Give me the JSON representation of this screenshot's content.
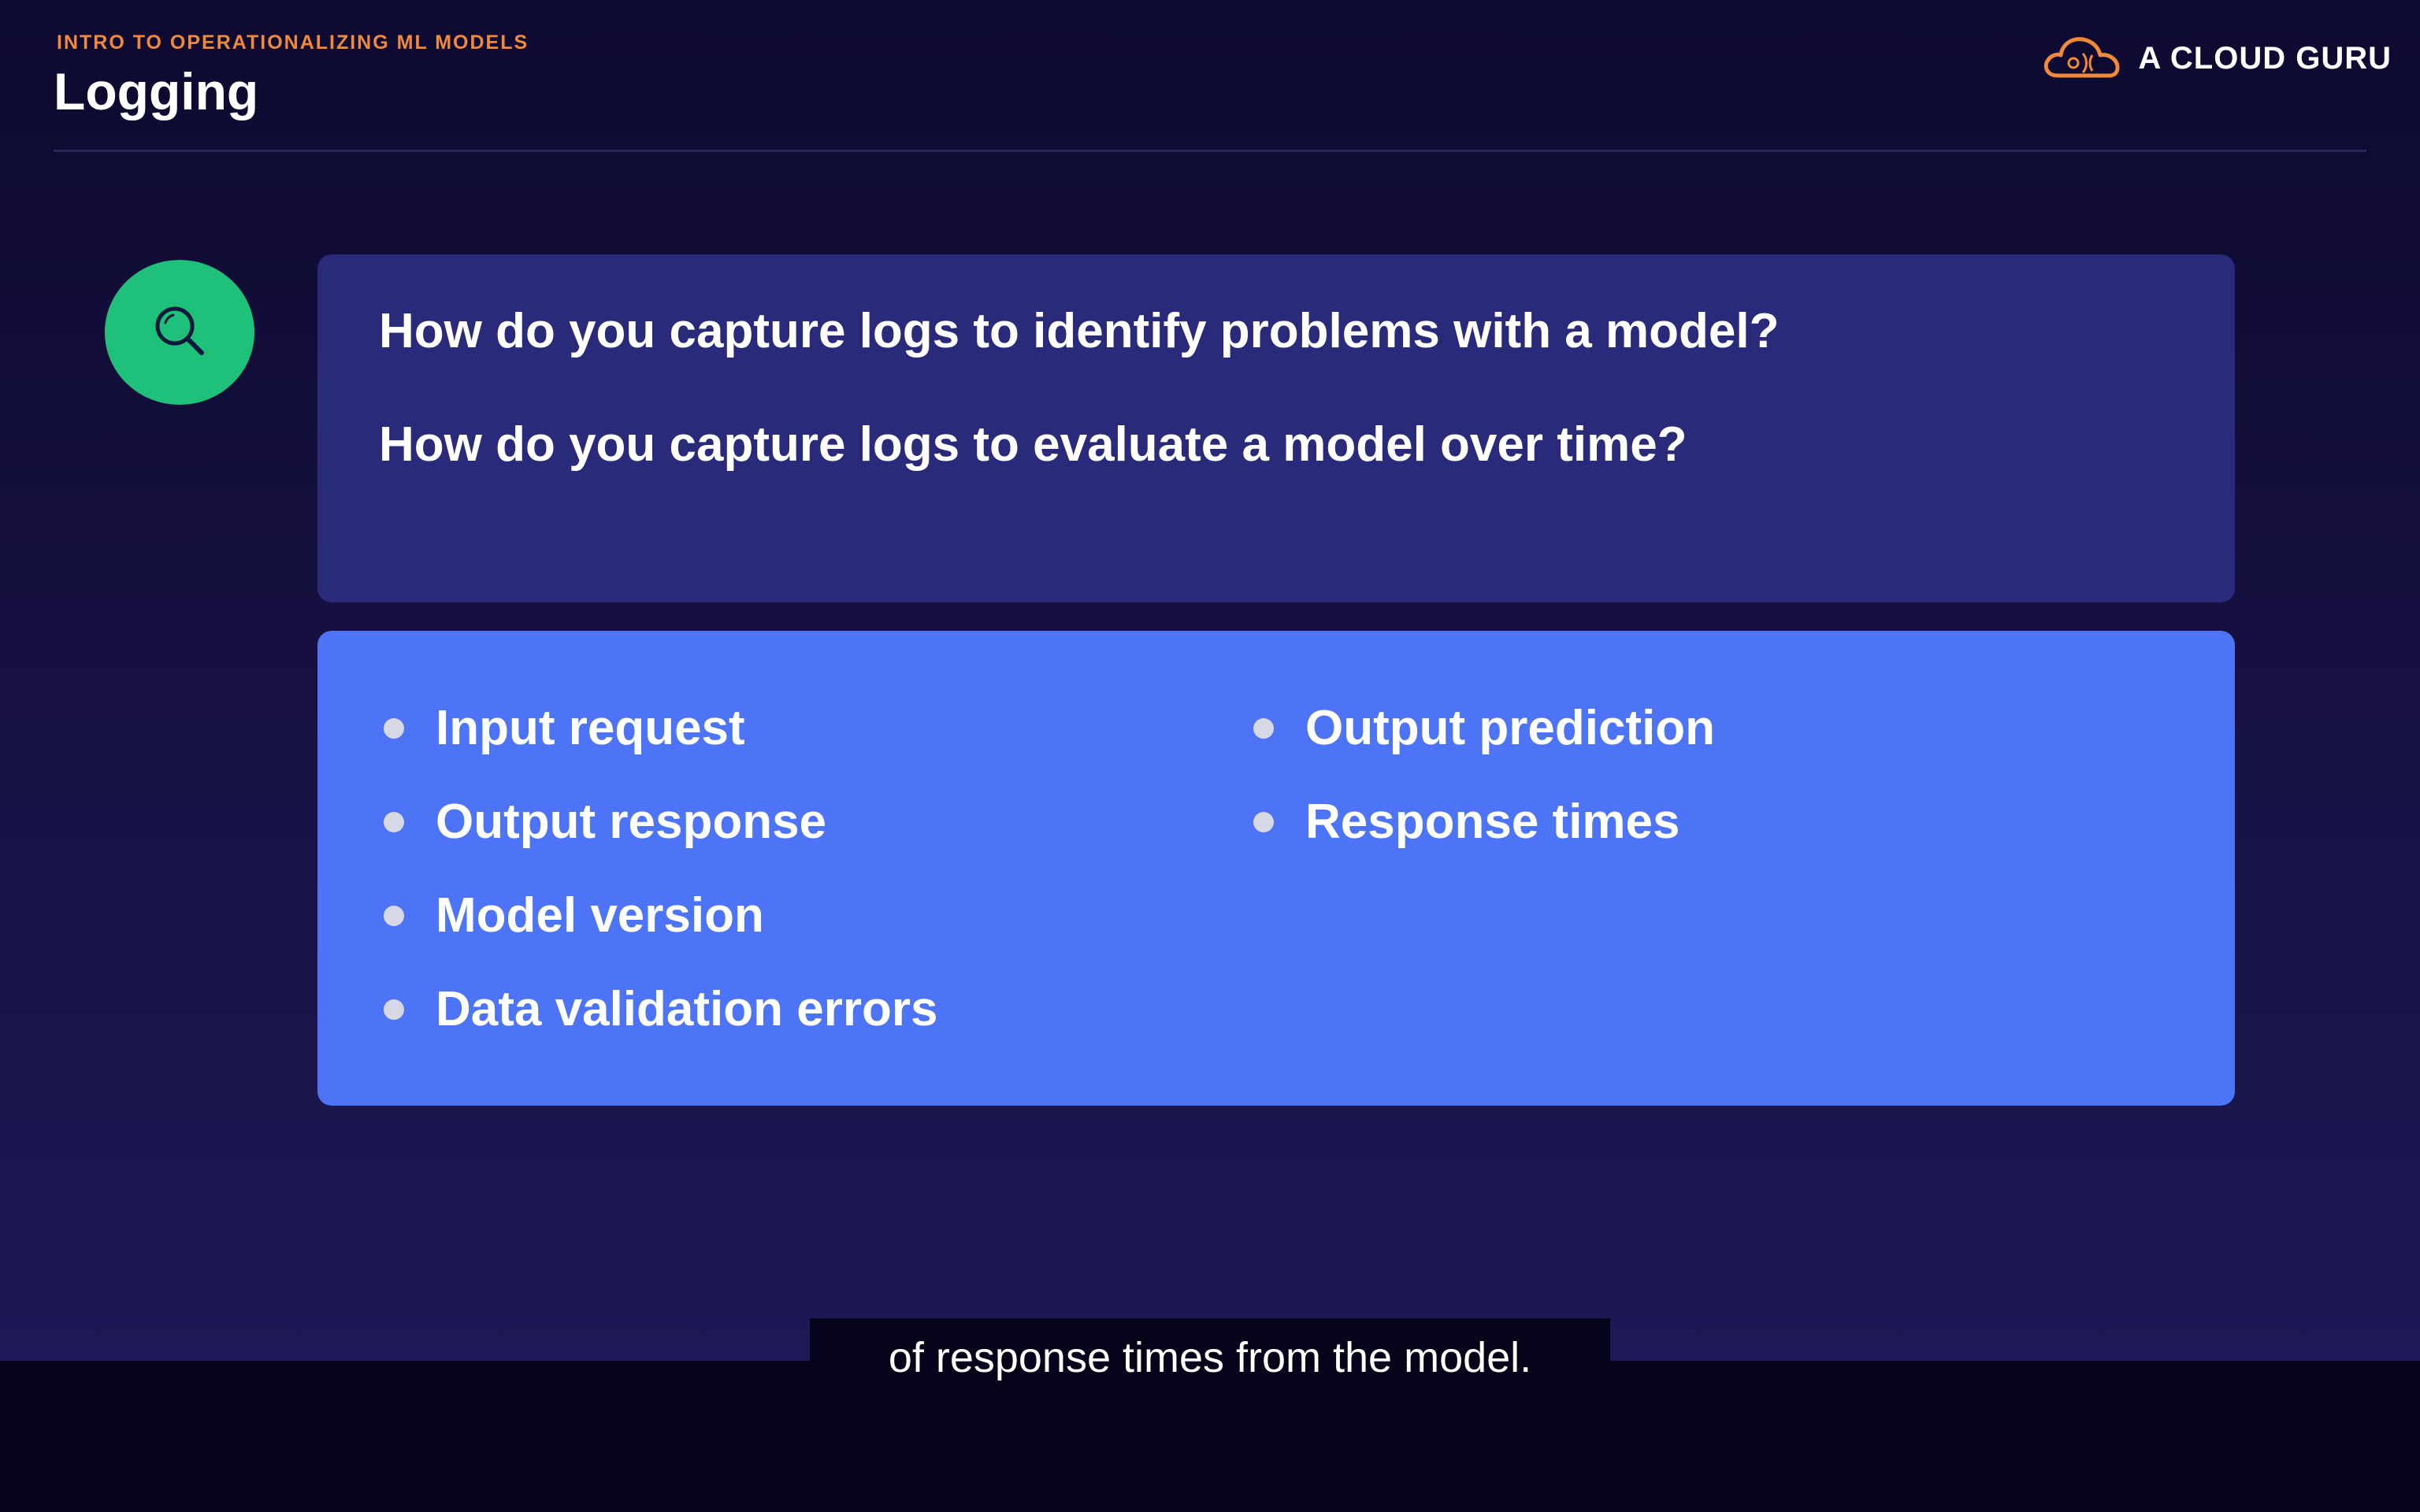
{
  "header": {
    "course_title": "INTRO TO OPERATIONALIZING ML MODELS",
    "slide_title": "Logging",
    "logo_text": "A CLOUD GURU",
    "logo_icon": "cloud-icon"
  },
  "questions": [
    "How do you capture logs to identify problems with a model?",
    "How do you capture logs to evaluate a model over time?"
  ],
  "search_icon": "search-icon",
  "log_items": {
    "left": [
      "Input request",
      "Output response",
      "Model version",
      "Data validation errors"
    ],
    "right": [
      "Output prediction",
      "Response times"
    ]
  },
  "subtitle": "of response times from the model.",
  "colors": {
    "accent_orange": "#f08a3a",
    "icon_green": "#1fc07a",
    "question_box": "#2a2a7b",
    "list_box": "#4d74f6"
  }
}
